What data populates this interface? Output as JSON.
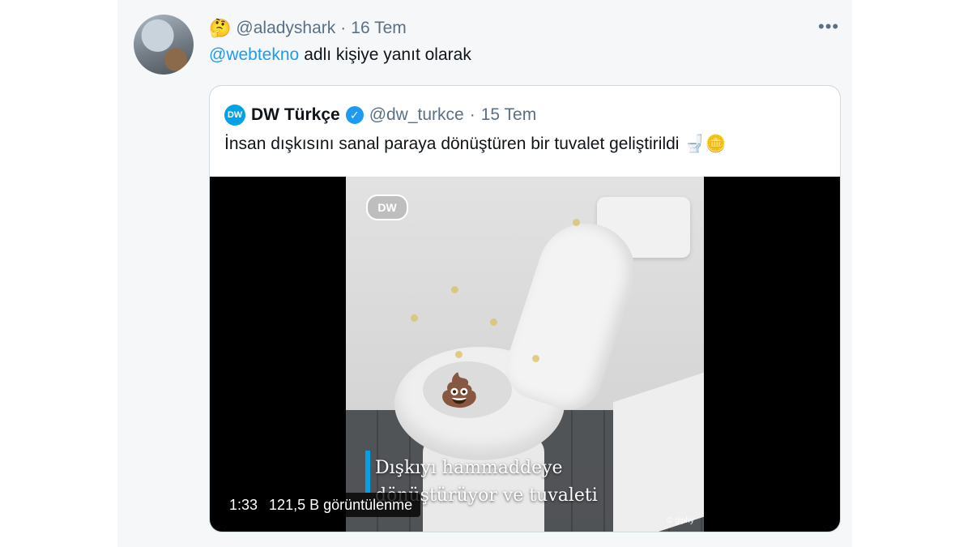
{
  "tweet": {
    "user_emoji": "🤔",
    "handle": "@aladyshark",
    "separator": "·",
    "date": "16 Tem",
    "more_icon": "more-dots-icon",
    "reply_mention": "@webtekno",
    "reply_text": "adlı kişiye yanıt olarak"
  },
  "quote": {
    "logo_text": "DW",
    "name": "DW Türkçe",
    "verified_icon": "verified-badge-icon",
    "handle": "@dw_turkce",
    "separator": "·",
    "date": "15 Tem",
    "text": "İnsan dışkısını sanal paraya dönüştüren bir tuvalet geliştirildi",
    "text_emojis": "🚽🪙"
  },
  "media": {
    "video_logo": "DW",
    "caption_line1": "Dışkıyı hammaddeye",
    "caption_line2": "dönüştürüyor ve tuvaleti",
    "watermark": "© giphy",
    "duration": "1:33",
    "views": "121,5 B görüntülenme",
    "poo_emoji": "💩"
  },
  "colors": {
    "accent": "#1d9bf0",
    "dw_blue": "#05a1e6",
    "muted": "#5b7083"
  }
}
